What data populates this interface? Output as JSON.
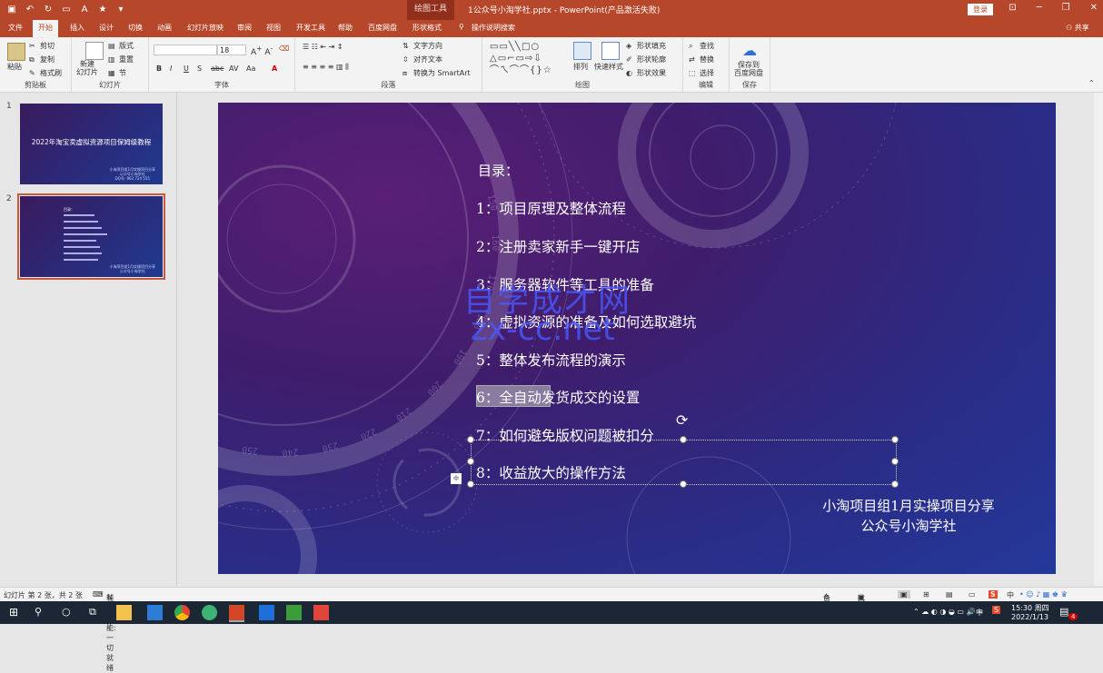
{
  "window": {
    "context_tab": "绘图工具",
    "doc_title": "1公众号小淘学社.pptx  -  PowerPoint(产品激活失败)",
    "login_button": "登录",
    "share": "共享"
  },
  "ribbon_tabs": [
    "文件",
    "开始",
    "插入",
    "设计",
    "切换",
    "动画",
    "幻灯片放映",
    "审阅",
    "视图",
    "开发工具",
    "帮助",
    "百度网盘",
    "形状格式"
  ],
  "active_tab": "开始",
  "tell_me": "操作说明搜索",
  "ribbon": {
    "clipboard": {
      "paste": "粘贴",
      "cut": "剪切",
      "copy": "复制",
      "format_painter": "格式刷",
      "label": "剪贴板"
    },
    "slides": {
      "new_slide": "新建\n幻灯片",
      "layout": "版式",
      "reset": "重置",
      "section": "节",
      "label": "幻灯片"
    },
    "font": {
      "font_name": "",
      "font_size": "18",
      "label": "字体"
    },
    "paragraph": {
      "text_direction": "文字方向",
      "align_text": "对齐文本",
      "smartart": "转换为 SmartArt",
      "label": "段落"
    },
    "drawing": {
      "arrange": "排列",
      "quick_styles": "快速样式",
      "shape_fill": "形状填充",
      "shape_outline": "形状轮廓",
      "shape_effects": "形状效果",
      "label": "绘图"
    },
    "editing": {
      "find": "查找",
      "replace": "替换",
      "select": "选择",
      "label": "编辑"
    },
    "save": {
      "save_to": "保存到\n百度网盘",
      "label": "保存"
    }
  },
  "thumbnails": [
    {
      "num": "1",
      "title": "2022年淘宝卖虚拟资源项目保姆级教程",
      "sub": "小淘项目组1月实操项目分享\n公众号小淘学社\nQQ号: 963 724 555"
    },
    {
      "num": "2",
      "title": "目录：",
      "sub": "小淘项目组1月实操项目分享\n公众号小淘学社"
    }
  ],
  "slide": {
    "heading": "目录：",
    "items": [
      "1：项目原理及整体流程",
      "2：注册卖家新手一键开店",
      "3：服务器软件等工具的准备",
      "4：虚拟资源的准备及如何选取避坑",
      "5：整体发布流程的演示",
      "6：全自动发货成交的设置",
      "7：如何避免版权问题被扣分",
      "8：收益放大的操作方法"
    ],
    "footer_line1": "小淘项目组1月实操项目分享",
    "footer_line2": "公众号小淘学社",
    "watermark1": "自学成才网",
    "watermark2": "zx-cc.net",
    "dial_numbers": [
      "150",
      "160",
      "170",
      "180",
      "190",
      "200",
      "210",
      "220",
      "230",
      "240",
      "250",
      "260",
      "270"
    ]
  },
  "status": {
    "slide_info": "幻灯片 第 2 张，共 2 张",
    "accessibility": "辅助功能: 一切就绪",
    "notes": "备注",
    "comments": "批注"
  },
  "taskbar": {
    "time": "15:30 周四",
    "date": "2022/1/13",
    "ime": "中",
    "notif_count": "4"
  },
  "colors": {
    "accent": "#b7472a",
    "slide_bg": "#3a2375",
    "watermark": "#4a5cff"
  }
}
